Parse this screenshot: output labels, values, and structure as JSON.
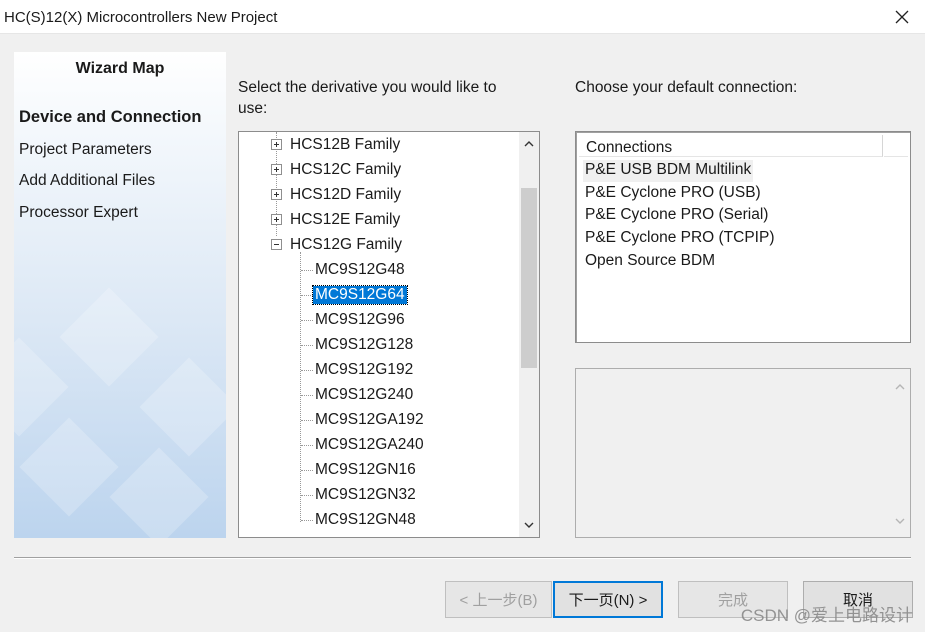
{
  "window": {
    "title": "HC(S)12(X) Microcontrollers New Project"
  },
  "wizard_map": {
    "title": "Wizard Map",
    "steps": [
      {
        "label": "Device and Connection",
        "active": true
      },
      {
        "label": "Project Parameters",
        "active": false
      },
      {
        "label": "Add Additional Files",
        "active": false
      },
      {
        "label": "Processor Expert",
        "active": false
      }
    ]
  },
  "derivative": {
    "label": "Select the derivative you would like to use:",
    "families": [
      {
        "label": "HCS12B Family",
        "expanded": false
      },
      {
        "label": "HCS12C Family",
        "expanded": false
      },
      {
        "label": "HCS12D Family",
        "expanded": false
      },
      {
        "label": "HCS12E Family",
        "expanded": false
      },
      {
        "label": "HCS12G Family",
        "expanded": true
      }
    ],
    "devices": [
      "MC9S12G48",
      "MC9S12G64",
      "MC9S12G96",
      "MC9S12G128",
      "MC9S12G192",
      "MC9S12G240",
      "MC9S12GA192",
      "MC9S12GA240",
      "MC9S12GN16",
      "MC9S12GN32",
      "MC9S12GN48"
    ],
    "selected_device": "MC9S12G64"
  },
  "connection": {
    "label": "Choose your default connection:",
    "column_header": "Connections",
    "items": [
      "P&E USB BDM Multilink",
      "P&E Cyclone PRO (USB)",
      "P&E Cyclone PRO (Serial)",
      "P&E Cyclone PRO (TCPIP)",
      "Open Source BDM"
    ],
    "selected_index": 0
  },
  "buttons": {
    "back": "< 上一步(B)",
    "next": "下一页(N) >",
    "finish": "完成",
    "cancel": "取消"
  },
  "watermark": "CSDN @爱上电路设计",
  "colors": {
    "selection": "#0078d7",
    "panel_gradient_end": "#bcd4ee"
  }
}
